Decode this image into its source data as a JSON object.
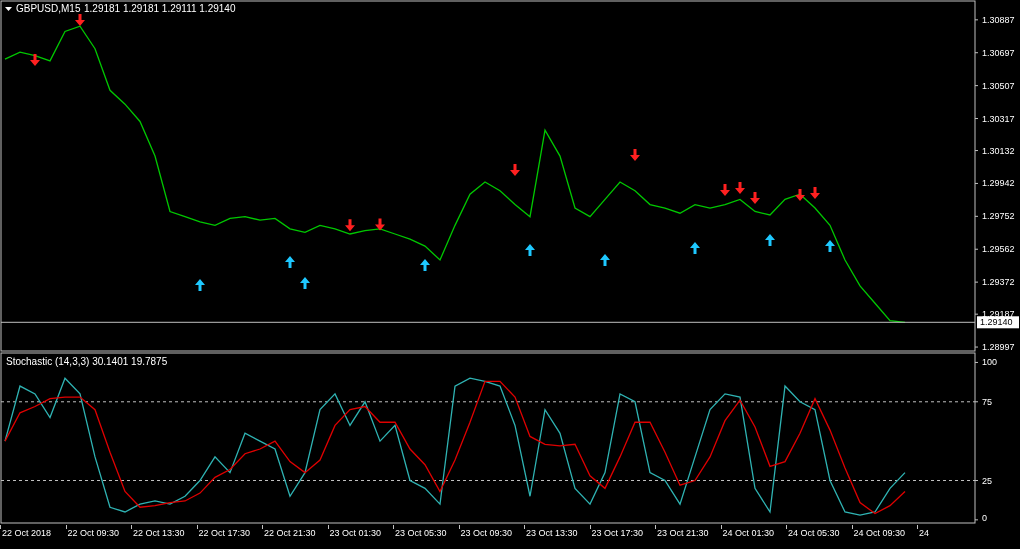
{
  "price_pane": {
    "symbol": "GBPUSD,M15",
    "quote": "1.29181 1.29181 1.29111 1.29140",
    "current_price": "1.29140",
    "chart_data": {
      "type": "line",
      "ylim": [
        1.2898,
        1.3099
      ],
      "ref_lines": [
        {
          "axis": "y",
          "value": 1.2914,
          "color": "#c0c0c0"
        }
      ],
      "yticks": [
        1.30887,
        1.30697,
        1.30507,
        1.30317,
        1.30132,
        1.29942,
        1.29752,
        1.29562,
        1.29372,
        1.29187,
        1.28997
      ],
      "series": [
        {
          "color": "#00c800",
          "values": [
            1.3066,
            1.307,
            1.3068,
            1.3065,
            1.3082,
            1.3085,
            1.3072,
            1.3048,
            1.304,
            1.303,
            1.301,
            1.2978,
            1.2975,
            1.2972,
            1.297,
            1.2974,
            1.2975,
            1.2973,
            1.2974,
            1.2968,
            1.2966,
            1.297,
            1.2968,
            1.2965,
            1.2967,
            1.2968,
            1.2965,
            1.2962,
            1.2958,
            1.295,
            1.297,
            1.2988,
            1.2995,
            1.299,
            1.2982,
            1.2975,
            1.3025,
            1.301,
            1.298,
            1.2975,
            1.2985,
            1.2995,
            1.299,
            1.2982,
            1.298,
            1.2977,
            1.2982,
            1.298,
            1.2982,
            1.2985,
            1.2978,
            1.2976,
            1.2985,
            1.2988,
            1.298,
            1.297,
            1.295,
            1.2935,
            1.2925,
            1.2915,
            1.2914
          ]
        },
        {
          "type": "scatter",
          "marker": "v",
          "color": "#ff2020",
          "values": [
            null,
            null,
            1.30655,
            null,
            null,
            1.30886,
            null,
            null,
            null,
            null,
            null,
            null,
            null,
            null,
            null,
            null,
            null,
            null,
            null,
            null,
            null,
            null,
            null,
            1.297,
            null,
            1.29705,
            null,
            null,
            null,
            null,
            null,
            null,
            null,
            null,
            1.3002,
            null,
            null,
            null,
            null,
            null,
            null,
            null,
            1.30106,
            null,
            null,
            null,
            null,
            null,
            1.29904,
            1.29916,
            1.29858,
            null,
            null,
            1.29875,
            1.29887,
            null,
            null,
            null,
            null,
            null,
            null
          ]
        },
        {
          "type": "scatter",
          "marker": "^",
          "color": "#1ec8ff",
          "values": [
            null,
            null,
            null,
            null,
            null,
            null,
            null,
            null,
            null,
            null,
            null,
            null,
            null,
            1.29355,
            null,
            null,
            null,
            null,
            null,
            1.29488,
            1.29367,
            null,
            null,
            null,
            null,
            null,
            null,
            null,
            1.29471,
            null,
            null,
            null,
            null,
            null,
            null,
            1.29558,
            null,
            null,
            null,
            null,
            1.295,
            null,
            null,
            null,
            null,
            null,
            1.29569,
            null,
            null,
            null,
            null,
            1.29615,
            null,
            null,
            null,
            1.29581,
            null,
            null,
            null,
            null,
            null
          ]
        }
      ]
    }
  },
  "indicator_pane": {
    "title": "Stochastic (14,3,3) 30.1401 19.7875",
    "chart_data": {
      "type": "line",
      "ylim": [
        -2,
        106
      ],
      "yticks": [
        100,
        75,
        25,
        0
      ],
      "series": [
        {
          "color": "#2fb3b3",
          "values": [
            50,
            85,
            80,
            65,
            90,
            80,
            40,
            8,
            5,
            10,
            12,
            10,
            15,
            25,
            40,
            30,
            55,
            50,
            45,
            15,
            30,
            70,
            80,
            60,
            75,
            50,
            60,
            25,
            20,
            10,
            85,
            90,
            88,
            85,
            60,
            15,
            70,
            55,
            20,
            10,
            30,
            80,
            75,
            30,
            25,
            10,
            40,
            70,
            80,
            78,
            20,
            5,
            85,
            75,
            70,
            25,
            5,
            3,
            5,
            20,
            30
          ]
        },
        {
          "color": "#e00000",
          "values": [
            50,
            68,
            72,
            77,
            78,
            78,
            70,
            43,
            18,
            8,
            9,
            11,
            12,
            17,
            27,
            32,
            42,
            45,
            50,
            37,
            30,
            38,
            60,
            70,
            72,
            62,
            62,
            45,
            35,
            18,
            38,
            62,
            88,
            88,
            78,
            53,
            48,
            47,
            48,
            28,
            20,
            40,
            62,
            62,
            43,
            22,
            25,
            40,
            63,
            76,
            59,
            34,
            37,
            55,
            77,
            57,
            33,
            11,
            4,
            9,
            18
          ]
        }
      ]
    }
  },
  "time_axis": {
    "labels": [
      "22 Oct 2018",
      "22 Oct 09:30",
      "22 Oct 13:30",
      "22 Oct 17:30",
      "22 Oct 21:30",
      "23 Oct 01:30",
      "23 Oct 05:30",
      "23 Oct 09:30",
      "23 Oct 13:30",
      "23 Oct 17:30",
      "23 Oct 21:30",
      "24 Oct 01:30",
      "24 Oct 05:30",
      "24 Oct 09:30",
      "24"
    ]
  }
}
